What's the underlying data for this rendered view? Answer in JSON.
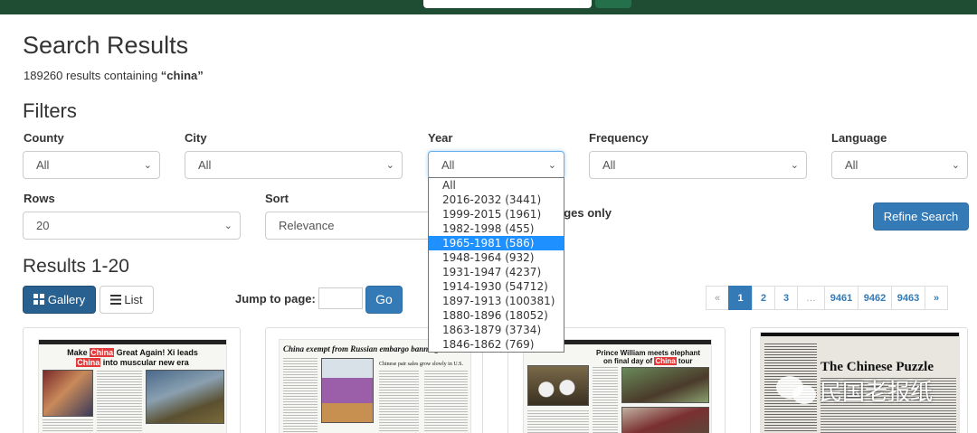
{
  "header": {
    "search_placeholder": ""
  },
  "page": {
    "title": "Search Results",
    "count": "189260",
    "summary_mid": " results containing ",
    "query": "“china”",
    "filters_title": "Filters",
    "results_title": "Results 1-20"
  },
  "filters": {
    "county": {
      "label": "County",
      "value": "All"
    },
    "city": {
      "label": "City",
      "value": "All"
    },
    "year": {
      "label": "Year",
      "value": "All"
    },
    "frequency": {
      "label": "Frequency",
      "value": "All"
    },
    "language": {
      "label": "Language",
      "value": "All"
    },
    "rows": {
      "label": "Rows",
      "value": "20"
    },
    "sort": {
      "label": "Sort",
      "value": "Relevance"
    },
    "front_pages_fragment": "ages only",
    "refine_label": "Refine Search"
  },
  "year_options": [
    "All",
    "2016-2032 (3441)",
    "1999-2015 (1961)",
    "1982-1998 (455)",
    "1965-1981 (586)",
    "1948-1964 (932)",
    "1931-1947 (4237)",
    "1914-1930 (54712)",
    "1897-1913 (100381)",
    "1880-1896 (18052)",
    "1863-1879 (3734)",
    "1846-1862 (769)"
  ],
  "year_selected_index": 4,
  "view": {
    "gallery_label": "Gallery",
    "list_label": "List"
  },
  "jump": {
    "label": "Jump to page:",
    "go_label": "Go"
  },
  "pagination": [
    "«",
    "1",
    "2",
    "3",
    "…",
    "9461",
    "9462",
    "9463",
    "»"
  ],
  "pagination_active": "1",
  "cards": [
    {
      "headline_pre": "Make ",
      "headline_hl": "China",
      "headline_post": " Great Again! Xi leads",
      "headline2_pre": "",
      "headline2_hl": "China",
      "headline2_post": " into muscular new era"
    },
    {
      "headline": "China exempt from Russian embargo banning W",
      "subhead": "Chinese pair sales grow slowly in U.S."
    },
    {
      "headline": "Prince William meets elephant",
      "headline2_pre": "on final day of ",
      "headline2_hl": "China",
      "headline2_post": " tour"
    },
    {
      "headline": "The Chinese Puzzle"
    }
  ],
  "watermark": "民国老报纸"
}
